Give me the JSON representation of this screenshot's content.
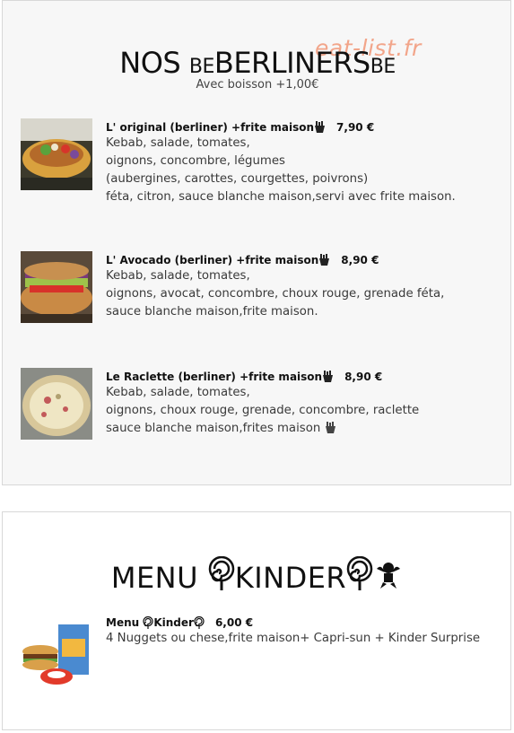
{
  "watermark": "eat-list.fr",
  "section1": {
    "title_a": "NOS ",
    "title_b": "BE",
    "title_c": "BERLINERS",
    "title_d": "BE",
    "subtitle": "Avec boisson +1,00€",
    "items": [
      {
        "name": "L'  original  (berliner) +frite maison",
        "price": "7,90 €",
        "desc": [
          "Kebab, salade, tomates,",
          "oignons, concombre, légumes",
          "(aubergines, carottes, courgettes, poivrons)",
          "féta, citron, sauce blanche maison,servi avec frite maison."
        ]
      },
      {
        "name": "L'  Avocado  (berliner) +frite maison",
        "price": "8,90 €",
        "desc": [
          "Kebab, salade, tomates,",
          "oignons, avocat, concombre, choux rouge, grenade féta,",
          "sauce blanche maison,frite maison."
        ]
      },
      {
        "name": "Le   Raclette  (berliner) +frite maison",
        "price": "8,90 €",
        "desc": [
          "Kebab, salade, tomates,",
          "oignons, choux rouge, grenade, concombre, raclette",
          "sauce blanche maison,frites maison"
        ]
      }
    ]
  },
  "section2": {
    "title_a": "MENU ",
    "title_b": "KINDER",
    "items": [
      {
        "name_a": "Menu ",
        "name_b": "Kinder",
        "price": "6,00 €",
        "desc": [
          "4 Nuggets ou chese,frite maison+ Capri-sun + Kinder Surprise"
        ]
      }
    ]
  },
  "icons": [
    "fries-icon",
    "lollipop-icon",
    "cherub-icon"
  ],
  "colors": {
    "watermark": "#f2a58a",
    "card_bg": "#f7f7f7",
    "border": "#d8d8d8"
  }
}
